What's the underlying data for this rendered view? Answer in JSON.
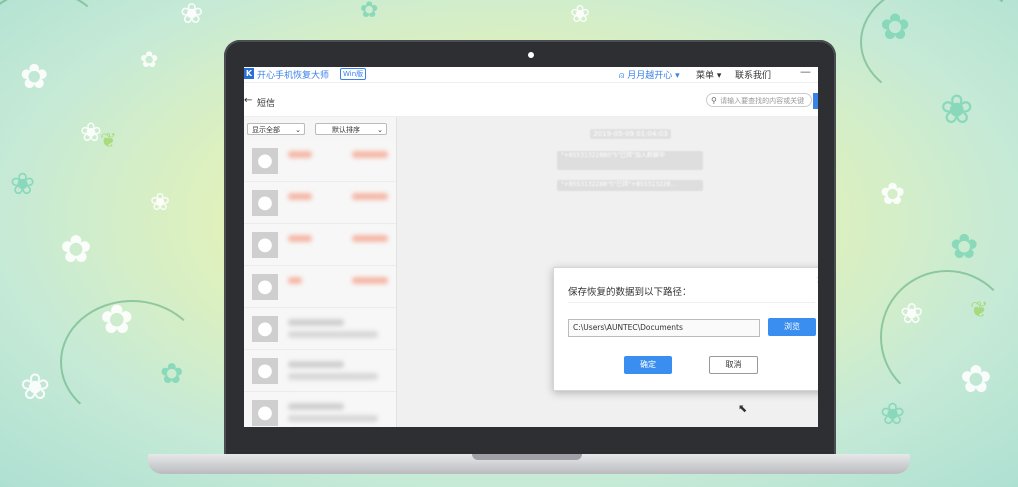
{
  "app": {
    "title": "开心手机恢复大师",
    "edition": "Win版",
    "user": "月月越开心",
    "menu": "菜单",
    "contact": "联系我们",
    "minimize": "—"
  },
  "nav": {
    "back": "←",
    "title": "短信",
    "search_placeholder": "请输入要查找的内容或关键"
  },
  "filters": {
    "show": "显示全部",
    "sort": "默认排序"
  },
  "messages": {
    "date": "2019-05-09 01:04:03",
    "bubble1": "\"+85531322880\"5\"已拜\"加入群聊中",
    "bubble2": "\"+8553132288\"5\"已拜\"+855313228..."
  },
  "dialog": {
    "title": "保存恢复的数据到以下路径：",
    "path": "C:\\Users\\AUNTEC\\Documents",
    "browse": "浏览",
    "ok": "确定",
    "cancel": "取消",
    "close": "×"
  },
  "icons": {
    "avatar": "person-icon",
    "search": "search-icon",
    "user": "user-icon",
    "cursor": "mouse-cursor-icon"
  },
  "colors": {
    "accent": "#3a8ef0",
    "brand": "#3a82e8",
    "blurred_name": "#f5b8a8"
  }
}
